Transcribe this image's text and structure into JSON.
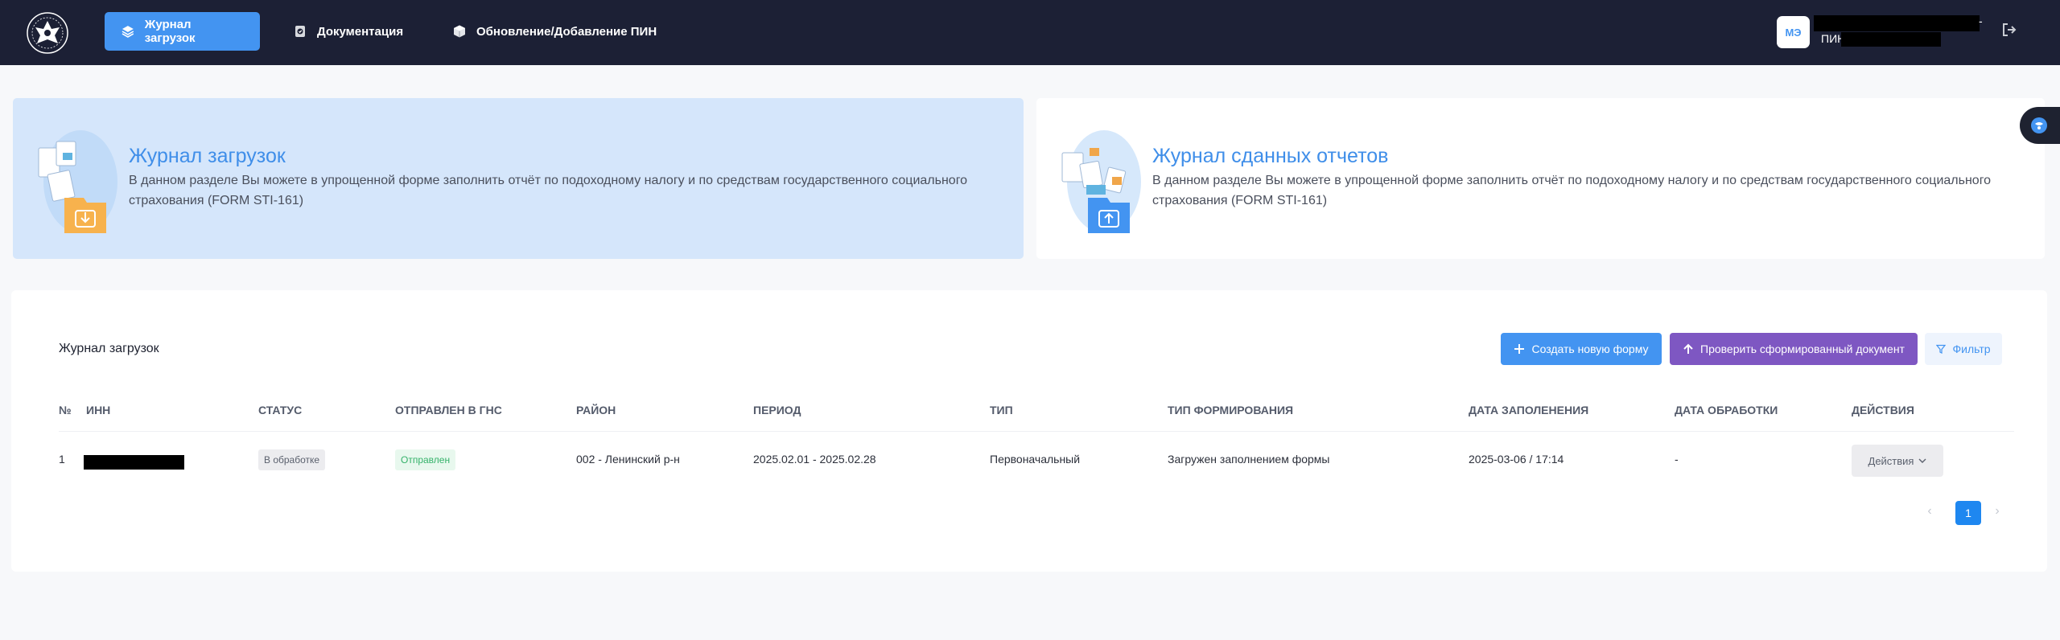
{
  "header": {
    "nav": {
      "upload_journal": "Журнал загрузок",
      "documentation": "Документация",
      "pin_update": "Обновление/Добавление ПИН"
    },
    "user": {
      "initials": "МЭ",
      "dash": "-",
      "pin_label": "ПИН"
    }
  },
  "cards": {
    "upload": {
      "title": "Журнал загрузок",
      "description": "В данном разделе Вы можете в упрощенной форме заполнить отчёт по подоходному налогу и по средствам государственного социального страхования (FORM STI-161)"
    },
    "reports": {
      "title": "Журнал сданных отчетов",
      "description": "В данном разделе Вы можете в упрощенной форме заполнить отчёт по подоходному налогу и по средствам государственного социального страхования (FORM STI-161)"
    }
  },
  "panel": {
    "title": "Журнал загрузок",
    "buttons": {
      "create": "Создать новую форму",
      "verify": "Проверить сформированный документ",
      "filter": "Фильтр"
    },
    "columns": {
      "num": "№",
      "inn": "ИНН",
      "status": "СТАТУС",
      "sent": "ОТПРАВЛЕН В ГНС",
      "district": "РАЙОН",
      "period": "ПЕРИОД",
      "type": "ТИП",
      "formation": "ТИП ФОРМИРОВАНИЯ",
      "filled_date": "ДАТА ЗАПОЛЕНЕНИЯ",
      "processed_date": "ДАТА ОБРАБОТКИ",
      "actions": "ДЕЙСТВИЯ"
    },
    "rows": [
      {
        "num": "1",
        "status": "В обработке",
        "sent": "Отправлен",
        "district": "002 - Ленинский р-н",
        "period": "2025.02.01 - 2025.02.28",
        "type": "Первоначальный",
        "formation": "Загружен заполнением формы",
        "filled_date": "2025-03-06 / 17:14",
        "processed_date": "-",
        "actions": "Действия"
      }
    ],
    "pagination": {
      "current": "1"
    }
  },
  "colors": {
    "header_bg": "#1c2035",
    "accent_blue": "#4394f1",
    "accent_purple": "#7e57c2",
    "card_active_bg": "#d5e6fb",
    "status_sent": "#35b26a"
  },
  "icons": [
    "emblem-logo",
    "layers-icon",
    "shield-doc-icon",
    "cube-icon",
    "logout-icon",
    "plus-icon",
    "arrow-up-icon",
    "filter-icon",
    "chevron-down-icon",
    "chat-icon"
  ]
}
